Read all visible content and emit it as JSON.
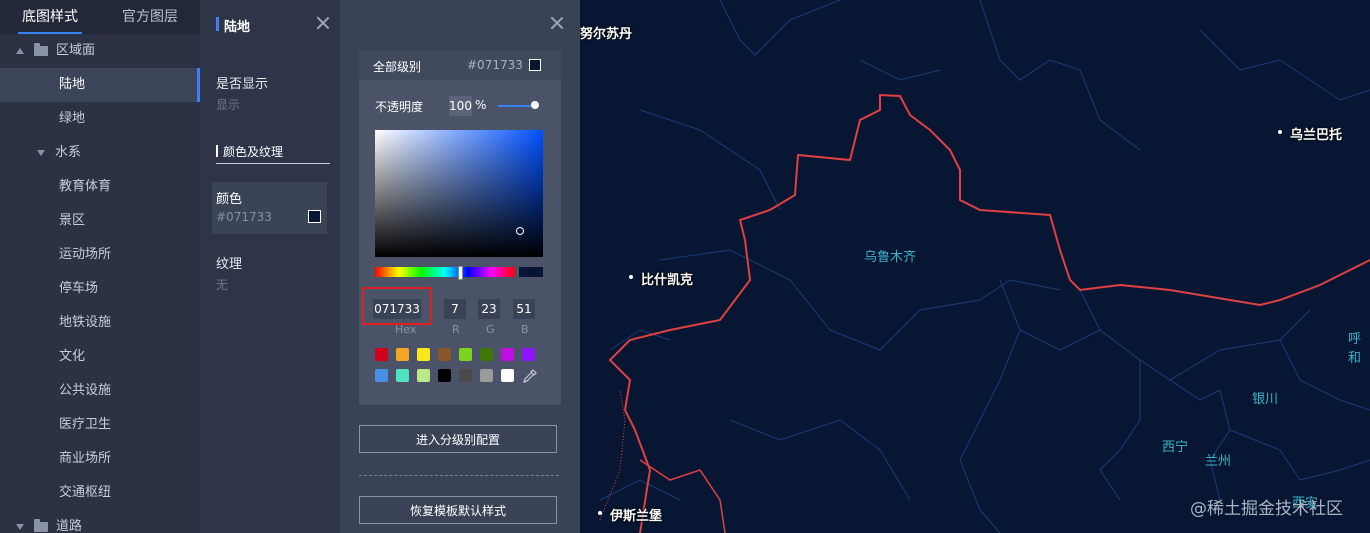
{
  "sidebar": {
    "tabs": [
      "底图样式",
      "官方图层"
    ],
    "groups": {
      "region": "区域面",
      "water": "水系",
      "road": "道路"
    },
    "items": [
      "陆地",
      "绿地",
      "教育体育",
      "景区",
      "运动场所",
      "停车场",
      "地铁设施",
      "文化",
      "公共设施",
      "医疗卫生",
      "商业场所",
      "交通枢纽"
    ]
  },
  "props": {
    "title": "陆地",
    "show_label": "是否显示",
    "show_value": "显示",
    "section": "颜色及纹理",
    "color_label": "颜色",
    "color_value": "#071733",
    "texture_label": "纹理",
    "texture_value": "无"
  },
  "colorpicker": {
    "level_label": "全部级别",
    "level_hex": "#071733",
    "opacity_label": "不透明度",
    "opacity_value": "100",
    "opacity_unit": "%",
    "hex": "071733",
    "r": "7",
    "g": "23",
    "b": "51",
    "hex_label": "Hex",
    "r_label": "R",
    "g_label": "G",
    "b_label": "B",
    "presets": [
      "#d0021b",
      "#f5a623",
      "#f8e71c",
      "#8b572a",
      "#7ed321",
      "#417505",
      "#bd10e0",
      "#9013fe",
      "#4a90e2",
      "#50e3c2",
      "#b8e986",
      "#000000",
      "#4a4a4a",
      "#9b9b9b",
      "#ffffff"
    ],
    "btn_level": "进入分级别配置",
    "btn_reset": "恢复模板默认样式",
    "current_color": "#071733"
  },
  "map": {
    "labels_white": [
      "努尔苏丹",
      "乌兰巴托",
      "比什凯克",
      "伊斯兰堡"
    ],
    "labels_teal": [
      "乌鲁木齐",
      "银川",
      "西宁",
      "兰州",
      "呼和",
      "西安"
    ],
    "watermark": "@稀土掘金技术社区"
  }
}
